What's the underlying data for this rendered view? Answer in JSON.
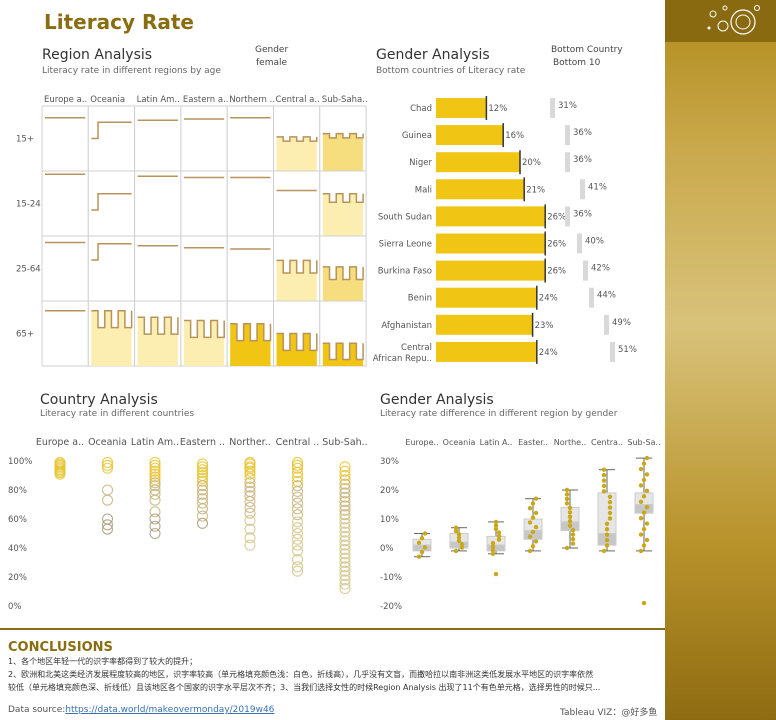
{
  "title": "Literacy Rate",
  "colors": {
    "accent": "#8a6d10",
    "bar": "#f0c514",
    "line": "#b8935a",
    "fill_light": "#fbeeb0",
    "fill_mid": "#f6dd7e",
    "fill_dark": "#f0c514",
    "marker": "#c9a81a",
    "grey": "#bdbdbd"
  },
  "region_analysis": {
    "title": "Region Analysis",
    "subtitle": "Literacy rate in different regions by age",
    "filter_label": "Gender",
    "filter_value": "female",
    "columns": [
      "Europe a..",
      "Oceania",
      "Latin Am..",
      "Eastern a..",
      "Northern ..",
      "Central a..",
      "Sub-Saha.."
    ],
    "rows": [
      "15+",
      "15-24",
      "25-64",
      "65+"
    ]
  },
  "gender_analysis_top": {
    "title": "Gender Analysis",
    "subtitle": "Bottom countries of Literacy rate",
    "filter_label": "Bottom Country",
    "filter_value": "Bottom 10",
    "chart_data": {
      "type": "bar",
      "categories": [
        "Chad",
        "Guinea",
        "Niger",
        "Mali",
        "South Sudan",
        "Sierra Leone",
        "Burkina Faso",
        "Benin",
        "Afghanistan",
        "Central African Repu.."
      ],
      "values": [
        12,
        16,
        20,
        21,
        26,
        26,
        26,
        24,
        23,
        24
      ],
      "value_labels": [
        "12%",
        "16%",
        "20%",
        "21%",
        "26%",
        "26%",
        "26%",
        "24%",
        "23%",
        "24%"
      ],
      "secondary_values": [
        31,
        36,
        36,
        41,
        36,
        40,
        42,
        44,
        49,
        51
      ],
      "secondary_labels": [
        "31%",
        "36%",
        "36%",
        "41%",
        "36%",
        "40%",
        "42%",
        "44%",
        "49%",
        "51%"
      ]
    }
  },
  "country_analysis": {
    "title": "Country Analysis",
    "subtitle": "Literacy rate in different countries",
    "chart_data": {
      "type": "scatter",
      "categories": [
        "Europe a..",
        "Oceania",
        "Latin Am..",
        "Eastern ..",
        "Norther..",
        "Central ..",
        "Sub-Sah.."
      ],
      "y_ticks": [
        "100%",
        "80%",
        "60%",
        "40%",
        "20%",
        "0%"
      ],
      "ylim": [
        0,
        100
      ],
      "points": [
        [
          99,
          98,
          97,
          96,
          95,
          94,
          93,
          92,
          91
        ],
        [
          99,
          97,
          95,
          80,
          73,
          60,
          56,
          53
        ],
        [
          99,
          97,
          95,
          93,
          91,
          89,
          87,
          85,
          83,
          80,
          77,
          73,
          65,
          60,
          55,
          50
        ],
        [
          98,
          96,
          94,
          92,
          90,
          88,
          86,
          83,
          80,
          77,
          74,
          71,
          67,
          62,
          57
        ],
        [
          99,
          98,
          96,
          95,
          93,
          91,
          88,
          85,
          82,
          79,
          76,
          72,
          68,
          64,
          59,
          53,
          47,
          42
        ],
        [
          99,
          97,
          95,
          92,
          89,
          86,
          83,
          79,
          75,
          71,
          67,
          63,
          58,
          54,
          50,
          46,
          42,
          38,
          32,
          27,
          24
        ],
        [
          96,
          93,
          90,
          87,
          84,
          81,
          78,
          75,
          72,
          69,
          66,
          63,
          60,
          57,
          54,
          51,
          48,
          45,
          42,
          39,
          36,
          33,
          30,
          27,
          24,
          21,
          18,
          15,
          12
        ]
      ]
    }
  },
  "gender_analysis_bottom": {
    "title": "Gender Analysis",
    "subtitle": "Literacy rate difference in different region by gender",
    "chart_data": {
      "type": "scatter",
      "categories": [
        "Europe..",
        "Oceania",
        "Latin A..",
        "Easter..",
        "Northe..",
        "Centra..",
        "Sub-Sa.."
      ],
      "y_ticks": [
        "30%",
        "20%",
        "10%",
        "0%",
        "-10%",
        "-20%"
      ],
      "ylim": [
        -20,
        30
      ],
      "boxes": [
        {
          "min": -3,
          "q1": -1,
          "median": 1,
          "q3": 3,
          "max": 5
        },
        {
          "min": -1,
          "q1": 0,
          "median": 2,
          "q3": 5,
          "max": 7
        },
        {
          "min": -2,
          "q1": -1,
          "median": 1,
          "q3": 4,
          "max": 9
        },
        {
          "min": -1,
          "q1": 3,
          "median": 6,
          "q3": 10,
          "max": 17
        },
        {
          "min": 0,
          "q1": 6,
          "median": 9,
          "q3": 14,
          "max": 20
        },
        {
          "min": -1,
          "q1": 1,
          "median": 5,
          "q3": 19,
          "max": 27
        },
        {
          "min": -1,
          "q1": 12,
          "median": 15,
          "q3": 19,
          "max": 31
        }
      ],
      "outliers": [
        [],
        [],
        [
          -9
        ],
        [],
        [],
        [],
        [
          -19
        ]
      ]
    }
  },
  "conclusions": {
    "title": "CONCLUSIONS",
    "line1": "1、各个地区年轻一代的识字率都得到了较大的提升；",
    "line2": "2、欧洲和北美这类经济发展程度较高的地区，识字率较高（单元格填充颜色浅：白色，折线高），几乎没有文盲，而撒哈拉以南非洲这类低发展水平地区的识字率依然",
    "line3": "较低（单元格填充颜色深、折线低）且该地区各个国家的识字水平层次不齐；3、当我们选择女性的时候Region Analysis 出现了11个有色单元格，选择男性的时候只..."
  },
  "footer": {
    "source_label": "Data source:",
    "source_link": "https://data.world/makeovermonday/2019w46",
    "viz": "Tableau VIZ：@好多鱼"
  }
}
